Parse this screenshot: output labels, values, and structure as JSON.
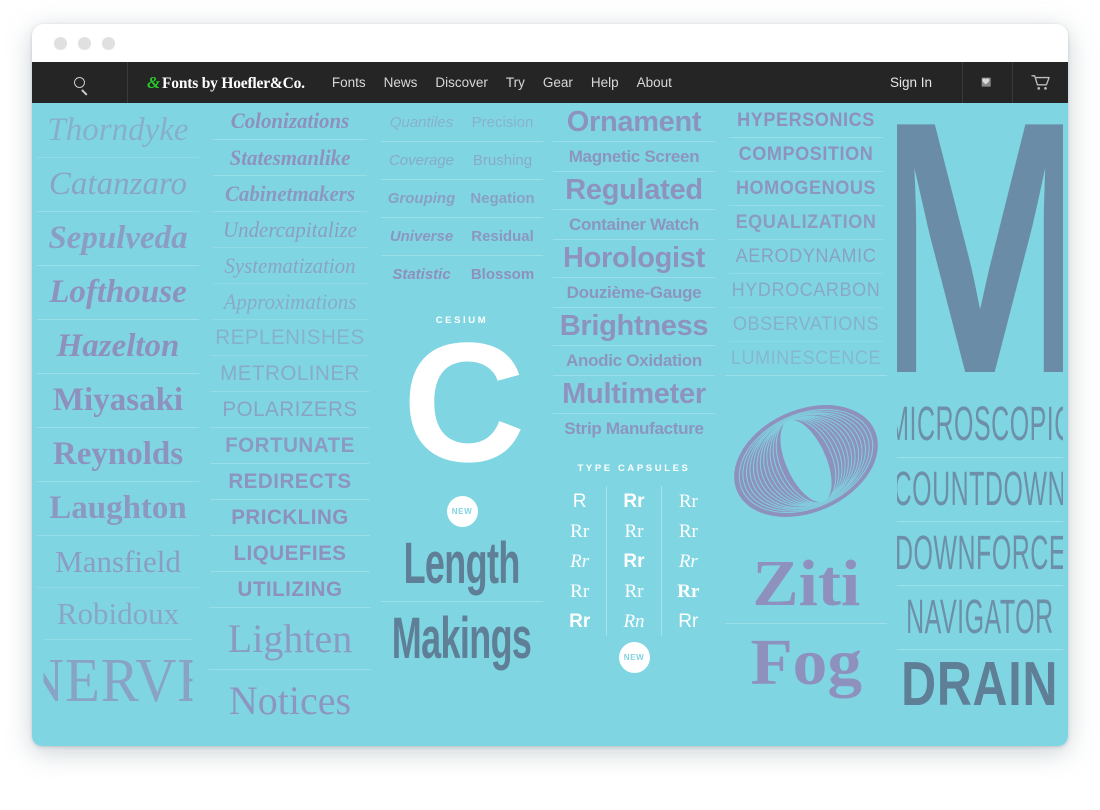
{
  "window": {
    "traffic_lights": [
      "close",
      "minimize",
      "zoom"
    ]
  },
  "nav": {
    "search_icon": "search-icon",
    "logo_amp": "&",
    "logo_text": "Fonts by Hoefler&Co.",
    "links": [
      "Fonts",
      "News",
      "Discover",
      "Try",
      "Gear",
      "Help",
      "About"
    ],
    "sign_in": "Sign In",
    "favorites_icon": "heart-icon",
    "cart_icon": "shopping-cart-icon"
  },
  "colors": {
    "background": "#7fd6e2",
    "specimen_text": "#8e90bd",
    "dark_specimen": "#5f7f96",
    "nav_background": "#252525",
    "accent_green": "#2ac72a",
    "white": "#ffffff"
  },
  "columns": [
    {
      "id": "column-1",
      "specimens": [
        {
          "text": "Thorndyke",
          "size": 33,
          "weight": 400,
          "italic": true,
          "opacity": 0.55
        },
        {
          "text": "Catanzaro",
          "size": 33,
          "weight": 400,
          "italic": true,
          "opacity": 0.7
        },
        {
          "text": "Sepulveda",
          "size": 33,
          "weight": 600,
          "italic": true,
          "opacity": 0.8
        },
        {
          "text": "Lofthouse",
          "size": 33,
          "weight": 700,
          "italic": true,
          "opacity": 0.95
        },
        {
          "text": "Hazelton",
          "size": 33,
          "weight": 700,
          "italic": true,
          "opacity": 1.0
        },
        {
          "text": "Miyasaki",
          "size": 33,
          "weight": 700,
          "italic": false,
          "opacity": 1.0
        },
        {
          "text": "Reynolds",
          "size": 33,
          "weight": 700,
          "italic": false,
          "opacity": 0.95
        },
        {
          "text": "Laughton",
          "size": 33,
          "weight": 600,
          "italic": false,
          "opacity": 0.88
        },
        {
          "text": "Mansfield",
          "size": 31,
          "weight": 400,
          "italic": false,
          "opacity": 0.8
        },
        {
          "text": "Robidoux",
          "size": 31,
          "weight": 400,
          "italic": false,
          "opacity": 0.68
        },
        {
          "text": "NERVE",
          "size": 62,
          "weight": 300,
          "italic": false,
          "opacity": 0.72
        }
      ]
    },
    {
      "id": "column-2",
      "specimens": [
        {
          "text": "Colonizations",
          "size": 22,
          "weight": 700,
          "style": "slab-italic",
          "opacity": 1.0
        },
        {
          "text": "Statesmanlike",
          "size": 22,
          "weight": 700,
          "style": "slab-italic",
          "opacity": 0.95
        },
        {
          "text": "Cabinetmakers",
          "size": 22,
          "weight": 600,
          "style": "slab-italic",
          "opacity": 0.88
        },
        {
          "text": "Undercapitalize",
          "size": 22,
          "weight": 400,
          "style": "slab-italic",
          "opacity": 0.8
        },
        {
          "text": "Systematization",
          "size": 22,
          "weight": 400,
          "style": "slab-italic",
          "opacity": 0.7
        },
        {
          "text": "Approximations",
          "size": 22,
          "weight": 400,
          "style": "slab-italic",
          "opacity": 0.62
        },
        {
          "text": "REPLENISHES",
          "size": 21,
          "weight": 300,
          "style": "caps",
          "opacity": 0.52
        },
        {
          "text": "METROLINER",
          "size": 21,
          "weight": 400,
          "style": "caps",
          "opacity": 0.62
        },
        {
          "text": "POLARIZERS",
          "size": 21,
          "weight": 500,
          "style": "caps",
          "opacity": 0.74
        },
        {
          "text": "FORTUNATE",
          "size": 21,
          "weight": 600,
          "style": "caps",
          "opacity": 0.85
        },
        {
          "text": "REDIRECTS",
          "size": 21,
          "weight": 700,
          "style": "caps",
          "opacity": 0.93
        },
        {
          "text": "PRICKLING",
          "size": 21,
          "weight": 800,
          "style": "caps",
          "opacity": 1.0
        },
        {
          "text": "LIQUEFIES",
          "size": 21,
          "weight": 800,
          "style": "caps",
          "opacity": 1.0
        },
        {
          "text": "UTILIZING",
          "size": 21,
          "weight": 900,
          "style": "caps",
          "opacity": 1.0
        },
        {
          "text": "Lighten",
          "size": 40,
          "weight": 400,
          "style": "roman",
          "opacity": 0.85
        },
        {
          "text": "Notices",
          "size": 40,
          "weight": 400,
          "style": "roman",
          "opacity": 0.9
        }
      ]
    },
    {
      "id": "column-3",
      "pairs": [
        {
          "left": "Quantiles",
          "right": "Precision",
          "weight": 400,
          "opacity": 0.52
        },
        {
          "left": "Coverage",
          "right": "Brushing",
          "weight": 500,
          "opacity": 0.64
        },
        {
          "left": "Grouping",
          "right": "Negation",
          "weight": 600,
          "opacity": 0.78
        },
        {
          "left": "Universe",
          "right": "Residual",
          "weight": 700,
          "opacity": 0.9
        },
        {
          "left": "Statistic",
          "right": "Blossom",
          "weight": 800,
          "opacity": 1.0
        }
      ],
      "label": "CESIUM",
      "big_letter": "C",
      "badge": "NEW",
      "display": [
        {
          "text": "Length",
          "size": 58
        },
        {
          "text": "Makings",
          "size": 58
        }
      ]
    },
    {
      "id": "column-4",
      "specimens": [
        {
          "text": "Ornament",
          "size": 29,
          "opacity": 0.95
        },
        {
          "text": "Magnetic Screen",
          "size": 17,
          "opacity": 0.92
        },
        {
          "text": "Regulated",
          "size": 29,
          "opacity": 0.95
        },
        {
          "text": "Container Watch",
          "size": 17,
          "opacity": 0.92
        },
        {
          "text": "Horologist",
          "size": 29,
          "opacity": 0.95
        },
        {
          "text": "Douzième-Gauge",
          "size": 17,
          "opacity": 0.92
        },
        {
          "text": "Brightness",
          "size": 29,
          "opacity": 0.95
        },
        {
          "text": "Anodic Oxidation",
          "size": 17,
          "opacity": 0.92
        },
        {
          "text": "Multimeter",
          "size": 29,
          "opacity": 0.95
        },
        {
          "text": "Strip Manufacture",
          "size": 17,
          "opacity": 0.92
        }
      ],
      "label": "TYPE CAPSULES",
      "badge": "NEW",
      "rr_grid": [
        [
          {
            "text": "R",
            "style": "sans-thin"
          },
          {
            "text": "Rr",
            "style": "serif"
          },
          {
            "text": "Rr",
            "style": "serif-italic"
          },
          {
            "text": "Rr",
            "style": "serif-light"
          },
          {
            "text": "Rr",
            "style": "sans-bold"
          }
        ],
        [
          {
            "text": "Rr",
            "style": "sans-bold"
          },
          {
            "text": "Rr",
            "style": "serif"
          },
          {
            "text": "Rr",
            "style": "sans-black"
          },
          {
            "text": "Rr",
            "style": "serif-light"
          },
          {
            "text": "Rn",
            "style": "script-italic"
          }
        ],
        [
          {
            "text": "Rr",
            "style": "serif"
          },
          {
            "text": "Rr",
            "style": "serif"
          },
          {
            "text": "Rr",
            "style": "serif-italic"
          },
          {
            "text": "Rr",
            "style": "slab-bold"
          },
          {
            "text": "Rr",
            "style": "sans-light"
          }
        ]
      ]
    },
    {
      "id": "column-5",
      "specimens": [
        {
          "text": "HYPERSONICS",
          "size": 19,
          "weight": 900,
          "opacity": 1.0
        },
        {
          "text": "COMPOSITION",
          "size": 19,
          "weight": 800,
          "opacity": 0.96
        },
        {
          "text": "HOMOGENOUS",
          "size": 19,
          "weight": 700,
          "opacity": 0.9
        },
        {
          "text": "EQUALIZATION",
          "size": 19,
          "weight": 600,
          "opacity": 0.84
        },
        {
          "text": "AERODYNAMIC",
          "size": 19,
          "weight": 500,
          "opacity": 0.76
        },
        {
          "text": "HYDROCARBON",
          "size": 19,
          "weight": 400,
          "opacity": 0.66
        },
        {
          "text": "OBSERVATIONS",
          "size": 19,
          "weight": 300,
          "opacity": 0.55
        },
        {
          "text": "LUMINESCENCE",
          "size": 19,
          "weight": 300,
          "opacity": 0.44
        }
      ],
      "ornament": "O",
      "display": [
        {
          "text": "Ziti",
          "size": 66
        },
        {
          "text": "Fog",
          "size": 66
        }
      ]
    },
    {
      "id": "column-6",
      "big_letter": "M",
      "specimens": [
        {
          "text": "MICROSCOPIC",
          "size": 48,
          "weight": 300
        },
        {
          "text": "COUNTDOWN",
          "size": 48,
          "weight": 300
        },
        {
          "text": "DOWNFORCE",
          "size": 48,
          "weight": 300
        },
        {
          "text": "NAVIGATOR",
          "size": 48,
          "weight": 300
        },
        {
          "text": "DRAIN",
          "size": 62,
          "weight": 900
        }
      ]
    }
  ]
}
